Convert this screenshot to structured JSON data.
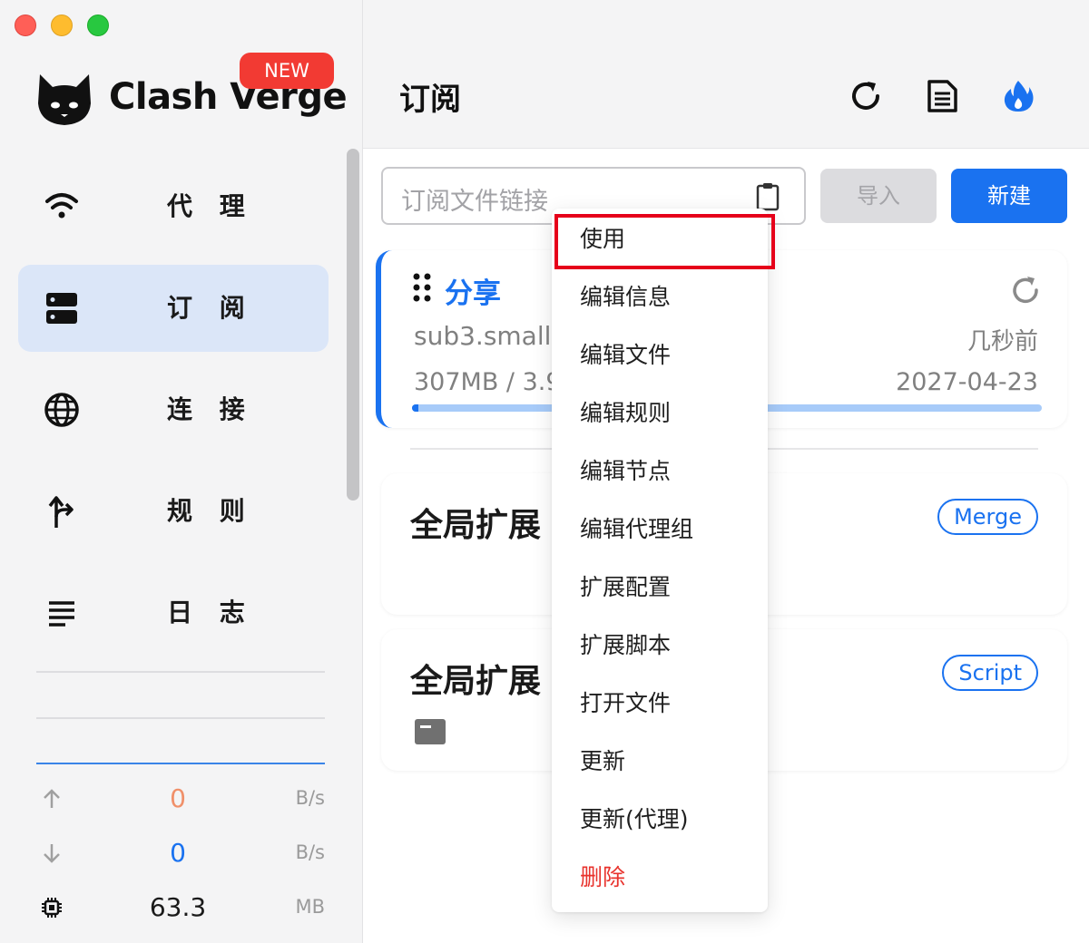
{
  "app": {
    "brand": "Clash Verge",
    "new_badge": "NEW"
  },
  "sidebar": {
    "items": [
      {
        "label": "代 理",
        "icon": "wifi-icon",
        "active": false
      },
      {
        "label": "订 阅",
        "icon": "server-icon",
        "active": true
      },
      {
        "label": "连 接",
        "icon": "globe-icon",
        "active": false
      },
      {
        "label": "规 则",
        "icon": "route-icon",
        "active": false
      },
      {
        "label": "日 志",
        "icon": "lines-icon",
        "active": false
      }
    ],
    "traffic": {
      "upload": {
        "value": "0",
        "unit": "B/s",
        "color": "#f0906a"
      },
      "download": {
        "value": "0",
        "unit": "B/s",
        "color": "#1a72f0"
      },
      "memory": {
        "value": "63.3",
        "unit": "MB"
      }
    }
  },
  "header": {
    "title": "订阅",
    "actions": [
      "refresh-icon",
      "logs-icon",
      "fire-icon"
    ]
  },
  "subscription": {
    "input_placeholder": "订阅文件链接",
    "import_label": "导入",
    "new_label": "新建"
  },
  "profile": {
    "name": "分享",
    "subtitle": "sub3.small",
    "updated": "几秒前",
    "usage": "307MB / 3.9",
    "expire": "2027-04-23",
    "progress_fraction": 0.01
  },
  "extensions": [
    {
      "title": "全局扩展",
      "tag": "Merge"
    },
    {
      "title": "全局扩展",
      "tag": "Script"
    }
  ],
  "context_menu": {
    "items": [
      {
        "label": "使用",
        "danger": false
      },
      {
        "label": "编辑信息",
        "danger": false
      },
      {
        "label": "编辑文件",
        "danger": false
      },
      {
        "label": "编辑规则",
        "danger": false
      },
      {
        "label": "编辑节点",
        "danger": false
      },
      {
        "label": "编辑代理组",
        "danger": false
      },
      {
        "label": "扩展配置",
        "danger": false
      },
      {
        "label": "扩展脚本",
        "danger": false
      },
      {
        "label": "打开文件",
        "danger": false
      },
      {
        "label": "更新",
        "danger": false
      },
      {
        "label": "更新(代理)",
        "danger": false
      },
      {
        "label": "删除",
        "danger": true
      }
    ],
    "highlighted_item": "使用"
  },
  "colors": {
    "accent": "#1a72f0",
    "danger": "#e8322c",
    "highlight_box": "#e6001a"
  }
}
